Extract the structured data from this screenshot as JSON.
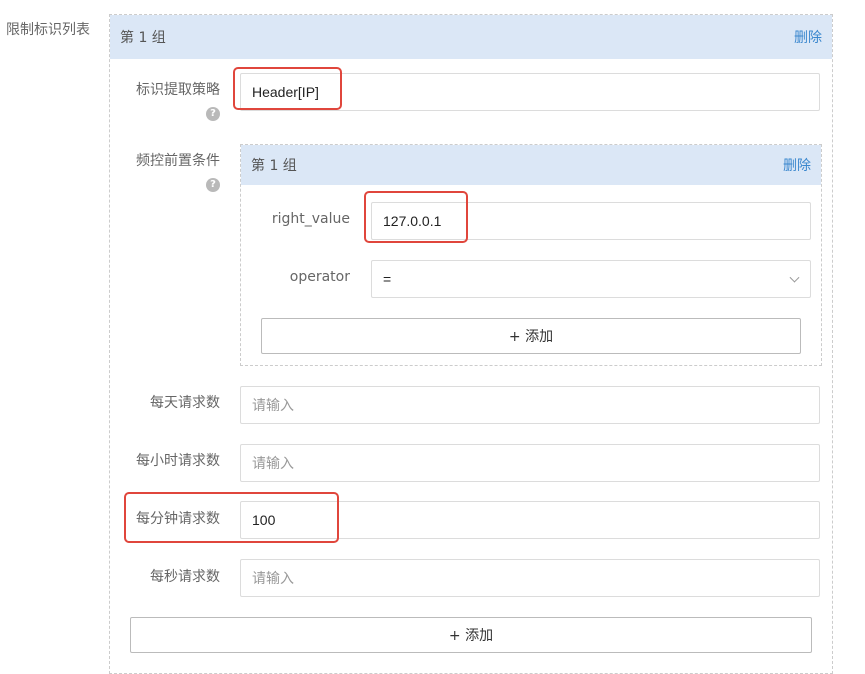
{
  "section_label": "限制标识列表",
  "outer_group": {
    "title": "第 1 组",
    "delete_label": "删除"
  },
  "strategy": {
    "label": "标识提取策略",
    "value": "Header[IP]"
  },
  "precondition": {
    "label": "频控前置条件",
    "group_title": "第 1 组",
    "delete_label": "删除",
    "right_value_label": "right_value",
    "right_value": "127.0.0.1",
    "operator_label": "operator",
    "operator_value": "=",
    "add_label": "+ 添加"
  },
  "per_day": {
    "label": "每天请求数",
    "placeholder": "请输入"
  },
  "per_hour": {
    "label": "每小时请求数",
    "placeholder": "请输入"
  },
  "per_minute": {
    "label": "每分钟请求数",
    "value": "100"
  },
  "per_second": {
    "label": "每秒请求数",
    "placeholder": "请输入"
  },
  "outer_add_label": "+ 添加",
  "help_glyph": "?",
  "colors": {
    "accent": "#3a87ce",
    "header_bg": "#dbe7f6",
    "highlight": "#e0463c"
  }
}
